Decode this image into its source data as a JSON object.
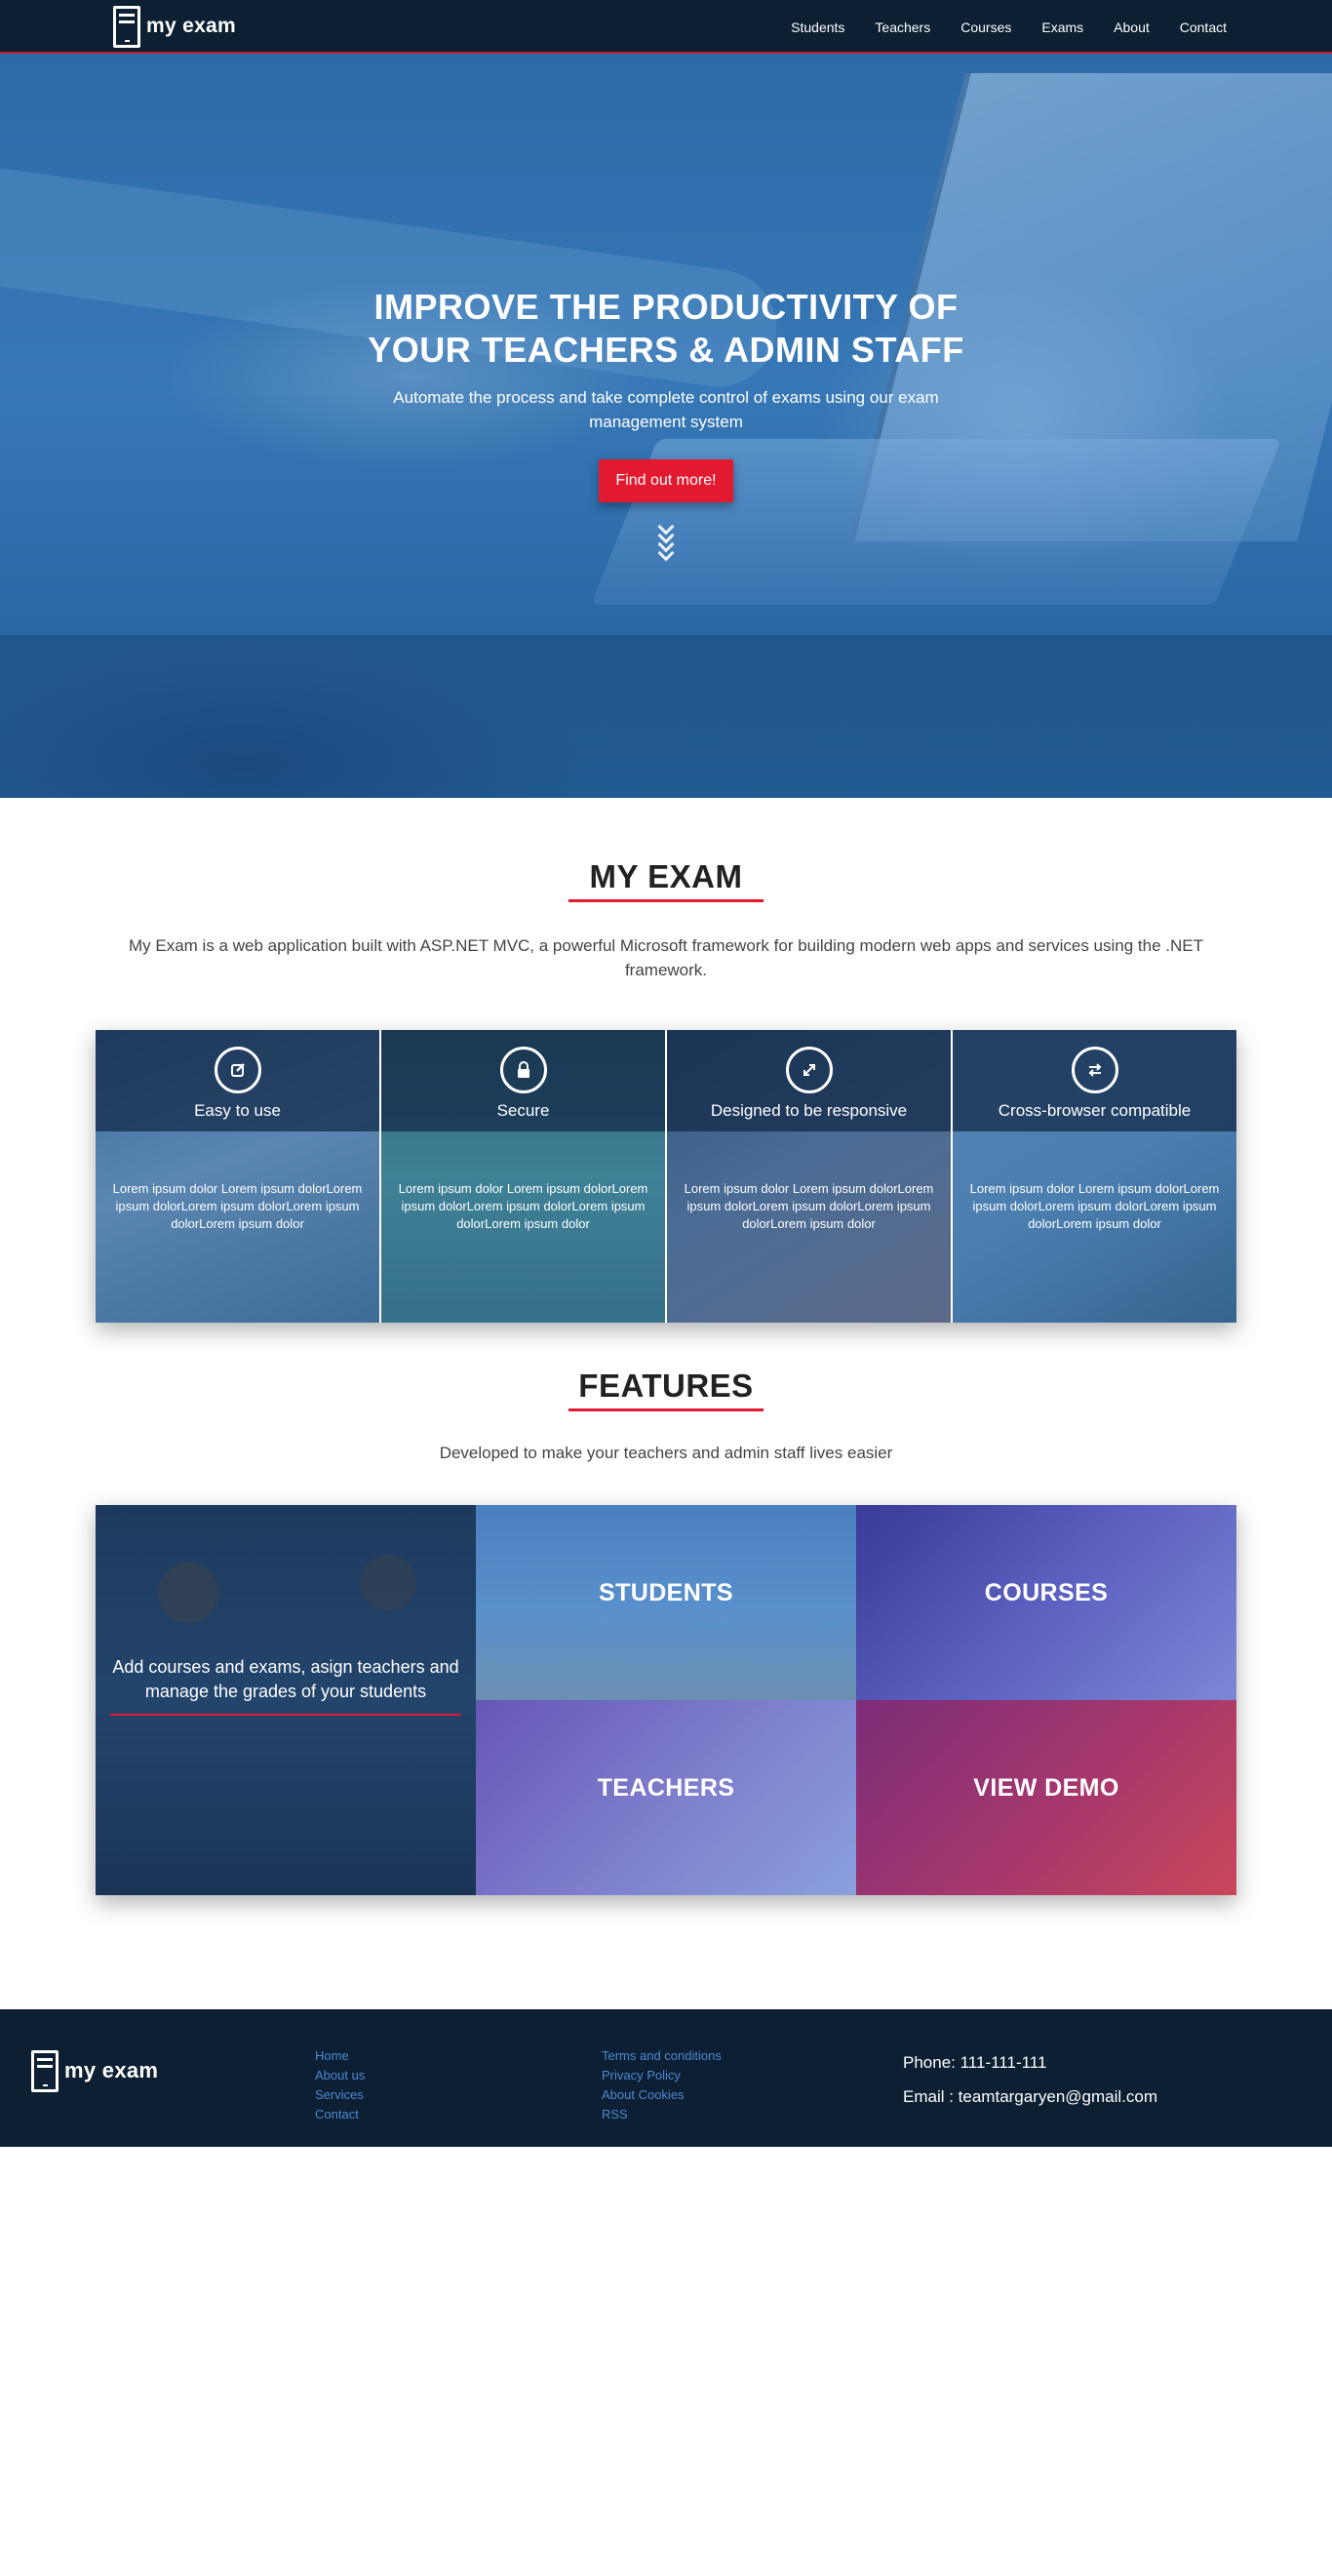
{
  "nav": {
    "brand": "my exam",
    "links": [
      "Students",
      "Teachers",
      "Courses",
      "Exams",
      "About",
      "Contact"
    ]
  },
  "hero": {
    "title": "IMPROVE THE PRODUCTIVITY OF YOUR TEACHERS & ADMIN STAFF",
    "subtitle": "Automate the process and take complete control of exams using our exam management system",
    "button": "Find out more!"
  },
  "about": {
    "title": "MY EXAM",
    "description": "My Exam is a web application built with ASP.NET MVC, a powerful Microsoft framework for building modern web apps and services using the .NET framework.",
    "cards": [
      {
        "label": "Easy to use",
        "icon": "edit-icon",
        "text": "Lorem ipsum dolor Lorem ipsum dolorLorem ipsum dolorLorem ipsum dolorLorem ipsum dolorLorem ipsum dolor"
      },
      {
        "label": "Secure",
        "icon": "lock-icon",
        "text": "Lorem ipsum dolor Lorem ipsum dolorLorem ipsum dolorLorem ipsum dolorLorem ipsum dolorLorem ipsum dolor"
      },
      {
        "label": "Designed to be responsive",
        "icon": "expand-icon",
        "text": "Lorem ipsum dolor Lorem ipsum dolorLorem ipsum dolorLorem ipsum dolorLorem ipsum dolorLorem ipsum dolor"
      },
      {
        "label": "Cross-browser compatible",
        "icon": "exchange-icon",
        "text": "Lorem ipsum dolor Lorem ipsum dolorLorem ipsum dolorLorem ipsum dolorLorem ipsum dolorLorem ipsum dolor"
      }
    ]
  },
  "features": {
    "title": "FEATURES",
    "description": "Developed to make your teachers and admin staff lives easier",
    "main_text": "Add courses and exams, asign teachers and manage the grades of your students",
    "tiles": {
      "students": "STUDENTS",
      "courses": "COURSES",
      "teachers": "TEACHERS",
      "demo": "VIEW DEMO"
    }
  },
  "footer": {
    "brand": "my exam",
    "links1": [
      "Home",
      "About us",
      "Services",
      "Contact"
    ],
    "links2": [
      "Terms and conditions",
      "Privacy Policy",
      "About Cookies",
      "RSS"
    ],
    "phone": "Phone: 111-111-111",
    "email": "Email : teamtargaryen@gmail.com"
  },
  "colors": {
    "navbar": "#0c1f33",
    "accent": "#e3192f",
    "hero_blue": "#3677b5",
    "footer_link": "#4d8ad4"
  }
}
